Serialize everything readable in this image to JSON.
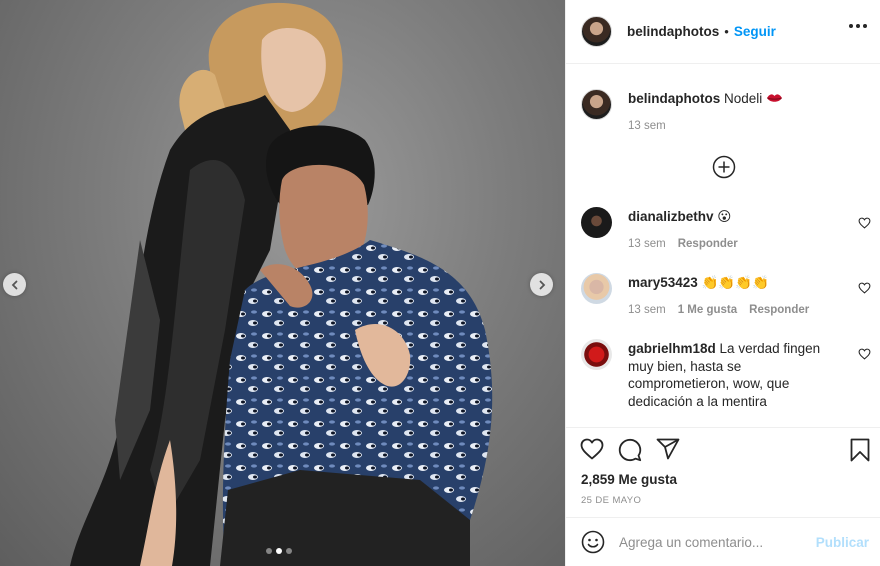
{
  "post": {
    "username": "belindaphotos",
    "separator": "•",
    "follow_label": "Seguir",
    "caption": {
      "username": "belindaphotos",
      "text": "Nodeli",
      "emoji": "lips-icon",
      "time": "13 sem"
    }
  },
  "comments": [
    {
      "username": "dianalizbethv",
      "text": "😮",
      "time": "13 sem",
      "reply_label": "Responder",
      "likes_label": ""
    },
    {
      "username": "mary53423",
      "text": "👏👏👏👏",
      "time": "13 sem",
      "likes_label": "1 Me gusta",
      "reply_label": "Responder"
    },
    {
      "username": "gabrielhm18d",
      "text": "La verdad fingen muy bien, hasta se comprometieron, wow, que dedicación a la mentira",
      "time": "",
      "likes_label": "",
      "reply_label": ""
    }
  ],
  "engagement": {
    "likes": "2,859 Me gusta",
    "date": "25 DE MAYO"
  },
  "comment_box": {
    "placeholder": "Agrega un comentario...",
    "publish_label": "Publicar"
  },
  "carousel": {
    "slides": 3,
    "active_index": 1
  },
  "colors": {
    "accent": "#0095f6",
    "publish_disabled": "#b2dffc",
    "muted": "#8e8e8e",
    "text": "#262626"
  }
}
